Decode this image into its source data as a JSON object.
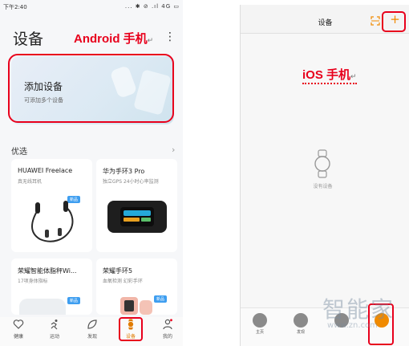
{
  "android": {
    "status_bar": {
      "time": "下午2:40",
      "icons": "... ✱ ⊘ .ıl 4G ▭"
    },
    "title": "设备",
    "annotation": "Android 手机",
    "add_card": {
      "title": "添加设备",
      "subtitle": "可添加多个设备"
    },
    "section": {
      "label": "优选",
      "arrow": "›"
    },
    "products": [
      {
        "name": "HUAWEI Freelace",
        "desc": "真无线耳机",
        "badge": "新品"
      },
      {
        "name": "华为手环3 Pro",
        "desc": "独立GPS 24小时心率监测",
        "badge": ""
      },
      {
        "name": "荣耀智能体脂秤Wi...",
        "desc": "17项身体指标",
        "badge": "新品"
      },
      {
        "name": "荣耀手环5",
        "desc": "血氧检测 幻彩手环",
        "badge": "新品"
      }
    ],
    "tabs": [
      {
        "label": "健康",
        "icon": "heart-icon"
      },
      {
        "label": "运动",
        "icon": "runner-icon"
      },
      {
        "label": "发现",
        "icon": "leaf-icon"
      },
      {
        "label": "设备",
        "icon": "watch-icon"
      },
      {
        "label": "我的",
        "icon": "person-icon"
      }
    ],
    "accent_color": "#e07b00"
  },
  "ios": {
    "title": "设备",
    "annotation": "iOS 手机",
    "plus": "+",
    "empty_text": "没有设备",
    "tabs": [
      {
        "label": "主页"
      },
      {
        "label": "发现"
      },
      {
        "label": ""
      },
      {
        "label": ""
      }
    ]
  },
  "watermark": {
    "text": "智能家",
    "url": "www.zn.com"
  },
  "highlight_color": "#e8001c"
}
